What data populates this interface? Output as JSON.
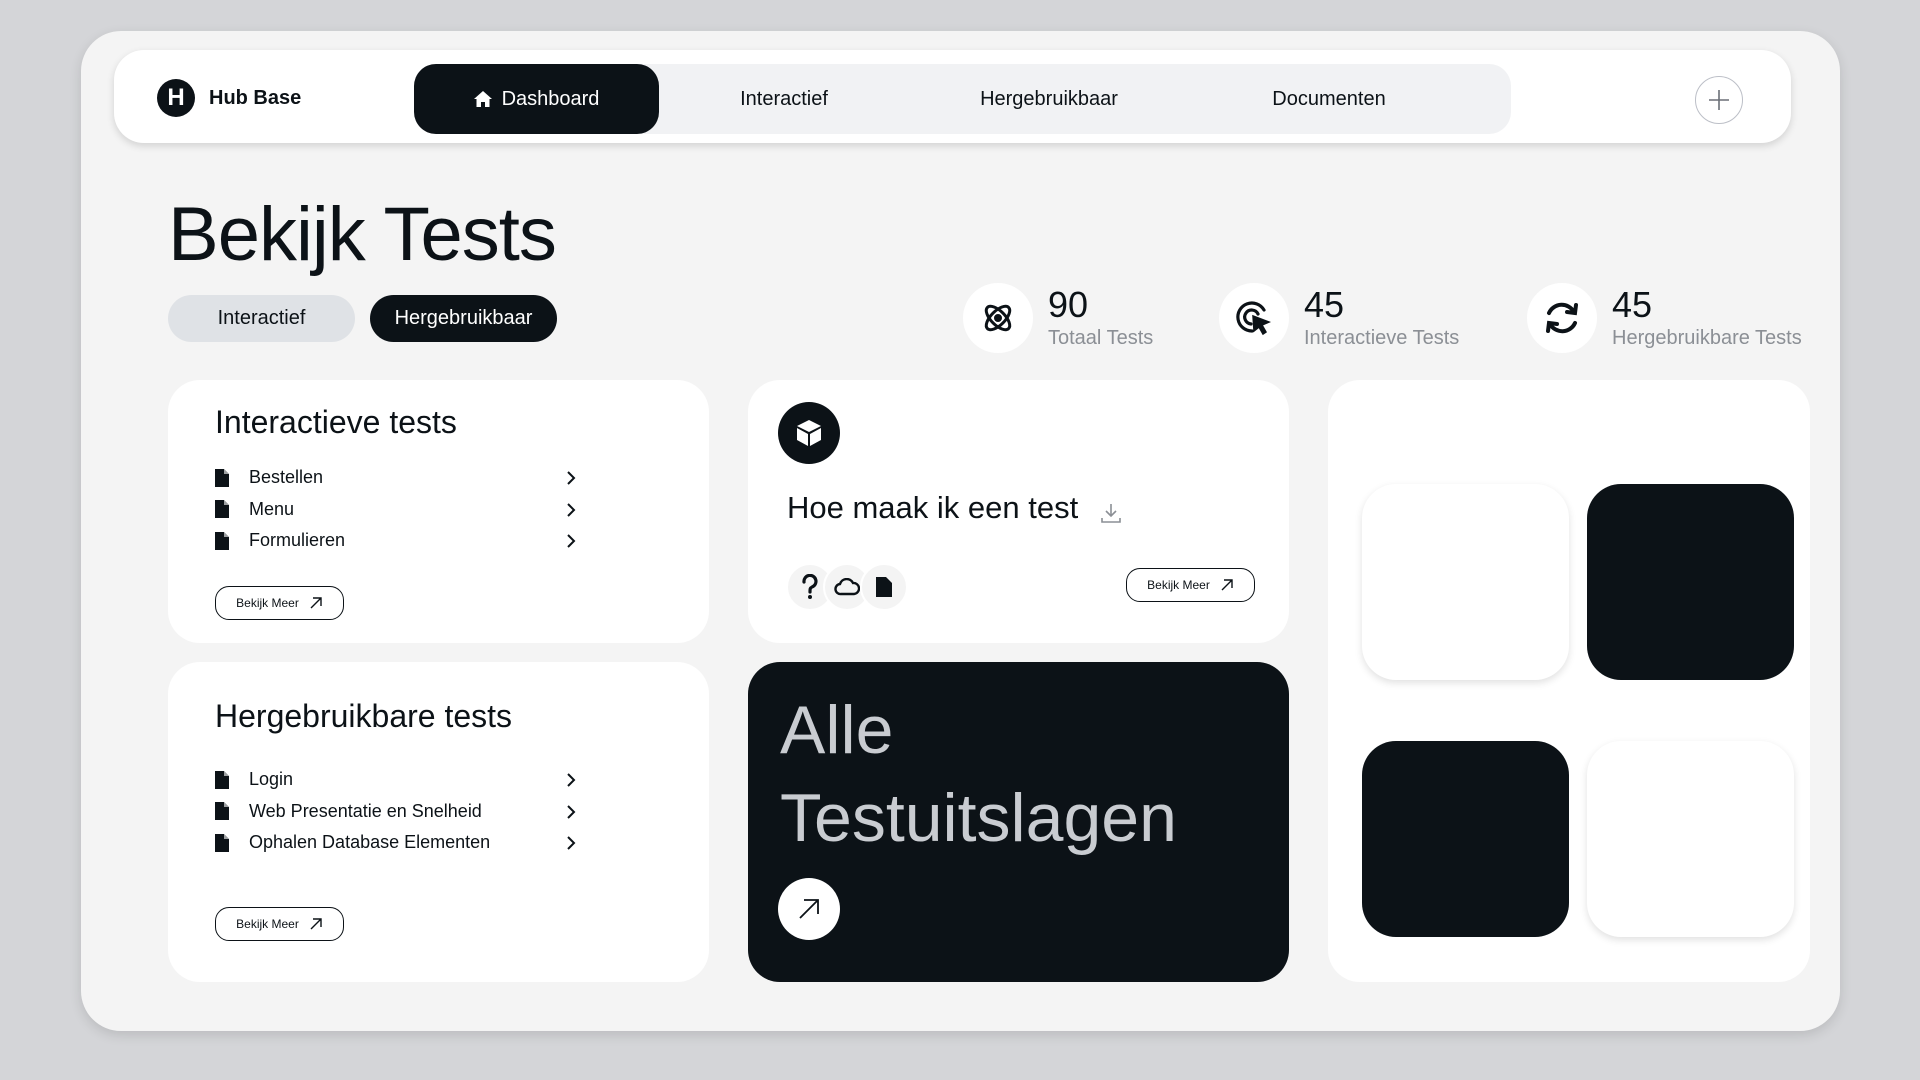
{
  "brand": {
    "logo_letter": "H",
    "name": "Hub Base"
  },
  "nav": {
    "tabs": [
      {
        "label": "Dashboard",
        "active": true
      },
      {
        "label": "Interactief",
        "active": false
      },
      {
        "label": "Hergebruikbaar",
        "active": false
      },
      {
        "label": "Documenten",
        "active": false
      }
    ]
  },
  "page": {
    "title": "Bekijk Tests",
    "filters": [
      {
        "label": "Interactief",
        "selected": false
      },
      {
        "label": "Hergebruikbaar",
        "selected": true
      }
    ]
  },
  "stats": [
    {
      "value": "90",
      "label": "Totaal Tests",
      "icon": "atom-icon"
    },
    {
      "value": "45",
      "label": "Interactieve Tests",
      "icon": "cursor-click-icon"
    },
    {
      "value": "45",
      "label": "Hergebruikbare Tests",
      "icon": "refresh-icon"
    }
  ],
  "interactive_card": {
    "title": "Interactieve tests",
    "items": [
      "Bestellen",
      "Menu",
      "Formulieren"
    ],
    "more_label": "Bekijk Meer"
  },
  "reusable_card": {
    "title": "Hergebruikbare tests",
    "items": [
      "Login",
      "Web Presentatie en Snelheid",
      "Ophalen Database Elementen"
    ],
    "more_label": "Bekijk Meer"
  },
  "howto_card": {
    "title": "Hoe maak ik een test",
    "more_label": "Bekijk Meer",
    "icons": [
      "question-icon",
      "cloud-icon",
      "document-icon"
    ]
  },
  "results_card": {
    "title_line1": "Alle",
    "title_line2": "Testuitslagen"
  },
  "colors": {
    "dark": "#0c1217",
    "background": "#f4f4f4",
    "outer": "#d4d5d8",
    "muted": "#8b8f95"
  }
}
